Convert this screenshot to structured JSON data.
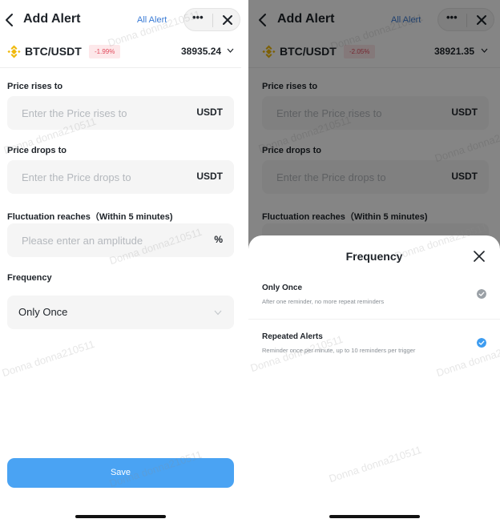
{
  "left": {
    "header": {
      "title": "Add Alert",
      "all_alert": "All Alert",
      "more": "•••"
    },
    "pair": {
      "symbol": "BTC/USDT",
      "change": "-1.99%",
      "price": "38935.24"
    },
    "price_rises": {
      "label": "Price rises to",
      "placeholder": "Enter the Price rises to",
      "unit": "USDT"
    },
    "price_drops": {
      "label": "Price drops to",
      "placeholder": "Enter the Price drops to",
      "unit": "USDT"
    },
    "fluctuation": {
      "label": "Fluctuation reaches（Within 5 minutes)",
      "placeholder": "Please enter an amplitude",
      "unit": "%"
    },
    "frequency": {
      "label": "Frequency",
      "value": "Only Once"
    },
    "save": "Save"
  },
  "right": {
    "header": {
      "title": "Add Alert",
      "all_alert": "All Alert",
      "more": "•••"
    },
    "pair": {
      "symbol": "BTC/USDT",
      "change": "-2.05%",
      "price": "38921.35"
    },
    "price_rises": {
      "label": "Price rises to",
      "placeholder": "Enter the Price rises to",
      "unit": "USDT"
    },
    "price_drops": {
      "label": "Price drops to",
      "placeholder": "Enter the Price drops to",
      "unit": "USDT"
    },
    "fluctuation": {
      "label": "Fluctuation reaches（Within 5 minutes)"
    },
    "sheet": {
      "title": "Frequency",
      "options": [
        {
          "title": "Only Once",
          "subtitle": "After one reminder, no more repeat reminders",
          "selected": false
        },
        {
          "title": "Repeated Alerts",
          "subtitle": "Reminder once per minute, up to 10 reminders per trigger",
          "selected": true
        }
      ]
    }
  },
  "watermark": "Donna donna210511",
  "colors": {
    "accent": "#4aa3f3",
    "link": "#3a7bd5",
    "negative": "#e04a5c",
    "bnb_gold": "#f0b90b",
    "check_selected": "#3d9cf0",
    "check_unselected": "#9aa0a6"
  }
}
